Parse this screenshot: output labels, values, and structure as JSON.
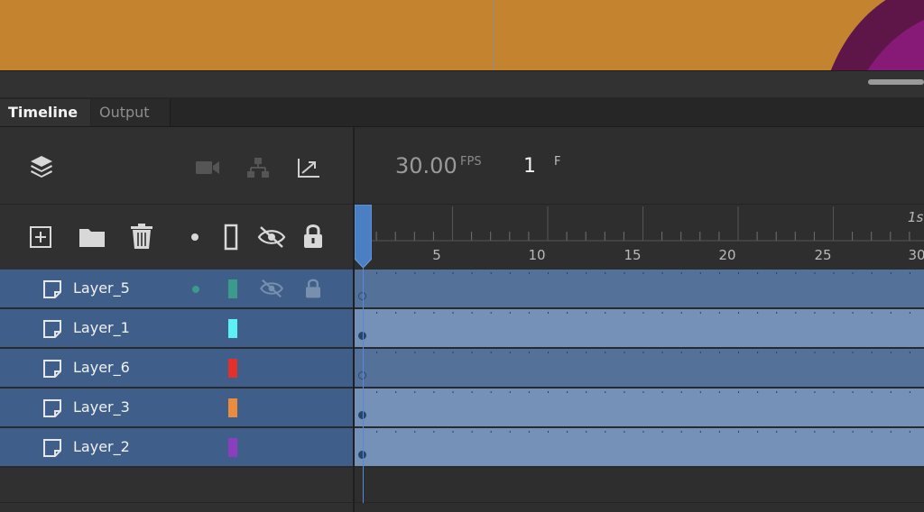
{
  "tabs": [
    {
      "label": "Timeline",
      "active": true
    },
    {
      "label": "Output",
      "active": false
    }
  ],
  "header": {
    "fps_value": "30.00",
    "fps_unit": "FPS",
    "frame_value": "1",
    "frame_unit": "F"
  },
  "toolbar_icons": [
    "layers-icon",
    "camera-icon",
    "hierarchy-icon",
    "graph-icon",
    "new-layer-icon",
    "folder-icon",
    "trash-icon",
    "highlight-dot-icon",
    "outline-icon",
    "visibility-icon",
    "lock-icon"
  ],
  "ruler": {
    "seconds_label": "1s",
    "ticks": [
      "5",
      "10",
      "15",
      "20",
      "25",
      "30"
    ]
  },
  "layers": [
    {
      "name": "Layer_5",
      "color": "#3a9a8c",
      "selected": true,
      "keyframe": "empty"
    },
    {
      "name": "Layer_1",
      "color": "#5cf0f5",
      "selected": false,
      "keyframe": "filled"
    },
    {
      "name": "Layer_6",
      "color": "#e3302b",
      "selected": true,
      "keyframe": "empty"
    },
    {
      "name": "Layer_3",
      "color": "#eb8b3c",
      "selected": false,
      "keyframe": "filled"
    },
    {
      "name": "Layer_2",
      "color": "#8b3fbf",
      "selected": false,
      "keyframe": "filled"
    }
  ],
  "colors": {
    "stage": "#c4832f",
    "layer_row": "#3f5f8a",
    "frame_row_selected": "#547299",
    "frame_row": "#7591b8",
    "playhead": "#4a7fc4"
  }
}
